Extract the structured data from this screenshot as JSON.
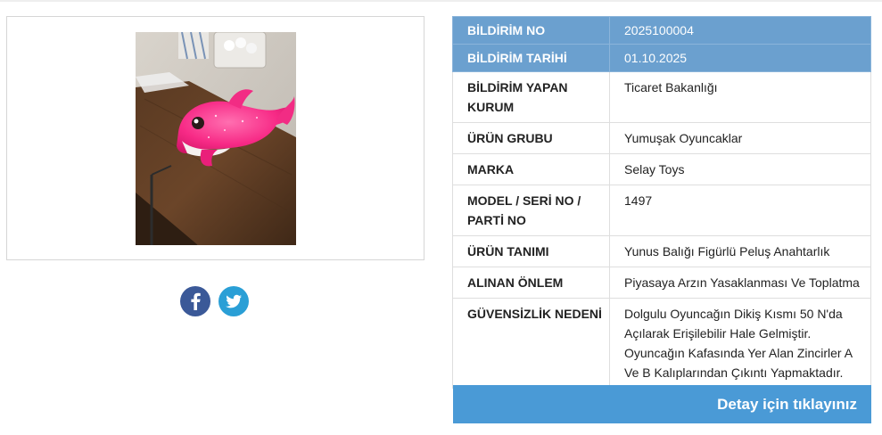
{
  "product_image": {
    "subject": "pink dolphin plush keychain"
  },
  "share": [
    {
      "network": "facebook",
      "icon": "facebook-icon",
      "color": "#3b5998"
    },
    {
      "network": "twitter",
      "icon": "twitter-icon",
      "color": "#2a9fd6"
    }
  ],
  "details": {
    "notice_no": {
      "label": "BİLDİRİM NO",
      "value": "2025100004"
    },
    "notice_date": {
      "label": "BİLDİRİM TARİHİ",
      "value": "01.10.2025"
    },
    "notifying_institution": {
      "label": "BİLDİRİM YAPAN KURUM",
      "value": "Ticaret Bakanlığı"
    },
    "product_group": {
      "label": "ÜRÜN GRUBU",
      "value": "Yumuşak Oyuncaklar"
    },
    "brand": {
      "label": "MARKA",
      "value": "Selay Toys"
    },
    "model": {
      "label": "MODEL / SERİ NO / PARTİ NO",
      "value": "1497"
    },
    "product_description": {
      "label": "ÜRÜN TANIMI",
      "value": "Yunus Balığı Figürlü Peluş Anahtarlık"
    },
    "measure_taken": {
      "label": "ALINAN ÖNLEM",
      "value": "Piyasaya Arzın Yasaklanması Ve Toplatma"
    },
    "risk_reason": {
      "label": "GÜVENSİZLİK NEDENİ",
      "value": "Dolgulu Oyuncağın Dikiş Kısmı 50 N'da Açılarak Erişilebilir Hale Gelmiştir. Oyuncağın Kafasında Yer Alan Zincirler A Ve B Kalıplarından Çıkıntı Yapmaktadır."
    }
  },
  "detail_button": {
    "label": "Detay için tıklayınız"
  },
  "colors": {
    "header_row": "#6ba0cf",
    "button": "#4a9ad6",
    "border": "#dedede"
  }
}
